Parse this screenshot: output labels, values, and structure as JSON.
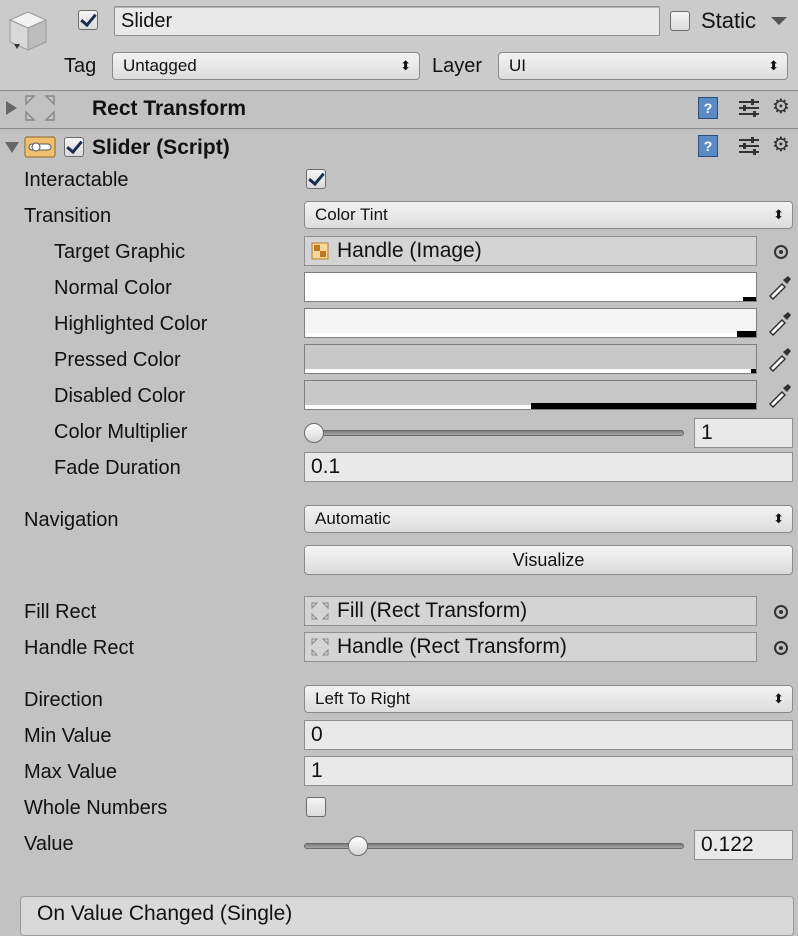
{
  "header": {
    "object_name": "Slider",
    "static_label": "Static",
    "tag_label": "Tag",
    "tag_value": "Untagged",
    "layer_label": "Layer",
    "layer_value": "UI",
    "active": true,
    "is_static": false
  },
  "components": {
    "rect_transform": {
      "title": "Rect Transform",
      "expanded": false
    },
    "slider": {
      "title": "Slider (Script)",
      "expanded": true,
      "enabled": true
    }
  },
  "fields": {
    "interactable": {
      "label": "Interactable",
      "checked": true
    },
    "transition": {
      "label": "Transition",
      "value": "Color Tint"
    },
    "target_graphic": {
      "label": "Target Graphic",
      "value": "Handle (Image)"
    },
    "normal_color": {
      "label": "Normal Color",
      "color": "#ffffff"
    },
    "highlighted_color": {
      "label": "Highlighted Color",
      "color": "#f5f5f5"
    },
    "pressed_color": {
      "label": "Pressed Color",
      "color": "#c8c8c8"
    },
    "disabled_color": {
      "label": "Disabled Color",
      "color": "#c8c8c8"
    },
    "color_multiplier": {
      "label": "Color Multiplier",
      "value": "1",
      "fraction": 0.0
    },
    "fade_duration": {
      "label": "Fade Duration",
      "value": "0.1"
    },
    "navigation": {
      "label": "Navigation",
      "value": "Automatic"
    },
    "visualize": {
      "label": "Visualize"
    },
    "fill_rect": {
      "label": "Fill Rect",
      "value": "Fill (Rect Transform)"
    },
    "handle_rect": {
      "label": "Handle Rect",
      "value": "Handle (Rect Transform)"
    },
    "direction": {
      "label": "Direction",
      "value": "Left To Right"
    },
    "min_value": {
      "label": "Min Value",
      "value": "0"
    },
    "max_value": {
      "label": "Max Value",
      "value": "1"
    },
    "whole_numbers": {
      "label": "Whole Numbers",
      "checked": false
    },
    "value": {
      "label": "Value",
      "value": "0.122",
      "fraction": 0.122
    }
  },
  "events": {
    "on_value_changed": "On Value Changed (Single)"
  },
  "icons": {
    "popup_arrows": "⬍",
    "gear": "⚙",
    "book": "?"
  }
}
